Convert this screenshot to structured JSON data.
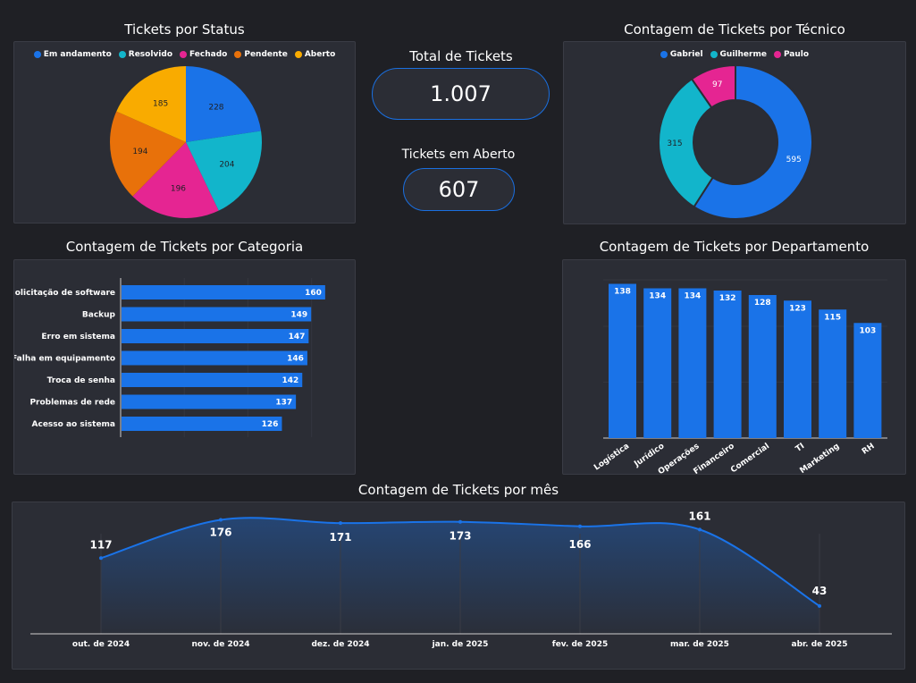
{
  "status": {
    "title": "Tickets por Status",
    "chart_data": {
      "type": "pie",
      "categories": [
        "Em andamento",
        "Resolvido",
        "Fechado",
        "Pendente",
        "Aberto"
      ],
      "values": [
        228,
        204,
        196,
        194,
        185
      ],
      "colors": [
        "#1a73e8",
        "#12b5cb",
        "#e52592",
        "#e8710a",
        "#f9ab00"
      ]
    }
  },
  "kpis": {
    "total_label": "Total de Tickets",
    "total_value": "1.007",
    "open_label": "Tickets em Aberto",
    "open_value": "607"
  },
  "tecnico": {
    "title": "Contagem de Tickets por Técnico",
    "chart_data": {
      "type": "pie",
      "donut": true,
      "categories": [
        "Gabriel",
        "Guilherme",
        "Paulo"
      ],
      "values": [
        595,
        315,
        97
      ],
      "colors": [
        "#1a73e8",
        "#12b5cb",
        "#e52592"
      ]
    }
  },
  "categoria": {
    "title": "Contagem de Tickets por Categoria",
    "chart_data": {
      "type": "bar",
      "orientation": "horizontal",
      "categories": [
        "Solicitação de software",
        "Backup",
        "Erro em sistema",
        "Falha em equipamento",
        "Troca de senha",
        "Problemas de rede",
        "Acesso ao sistema"
      ],
      "values": [
        160,
        149,
        147,
        146,
        142,
        137,
        126
      ],
      "color": "#1a73e8"
    }
  },
  "departamento": {
    "title": "Contagem de Tickets por Departamento",
    "chart_data": {
      "type": "bar",
      "categories": [
        "Logística",
        "Jurídico",
        "Operações",
        "Financeiro",
        "Comercial",
        "TI",
        "Marketing",
        "RH"
      ],
      "values": [
        138,
        134,
        134,
        132,
        128,
        123,
        115,
        103
      ],
      "color": "#1a73e8"
    }
  },
  "mes": {
    "title": "Contagem de Tickets por mês",
    "chart_data": {
      "type": "area",
      "categories": [
        "out. de 2024",
        "nov. de 2024",
        "dez. de 2024",
        "jan. de 2025",
        "fev. de 2025",
        "mar. de 2025",
        "abr. de 2025"
      ],
      "values": [
        117,
        176,
        171,
        173,
        166,
        161,
        43
      ],
      "color": "#1a73e8"
    }
  }
}
